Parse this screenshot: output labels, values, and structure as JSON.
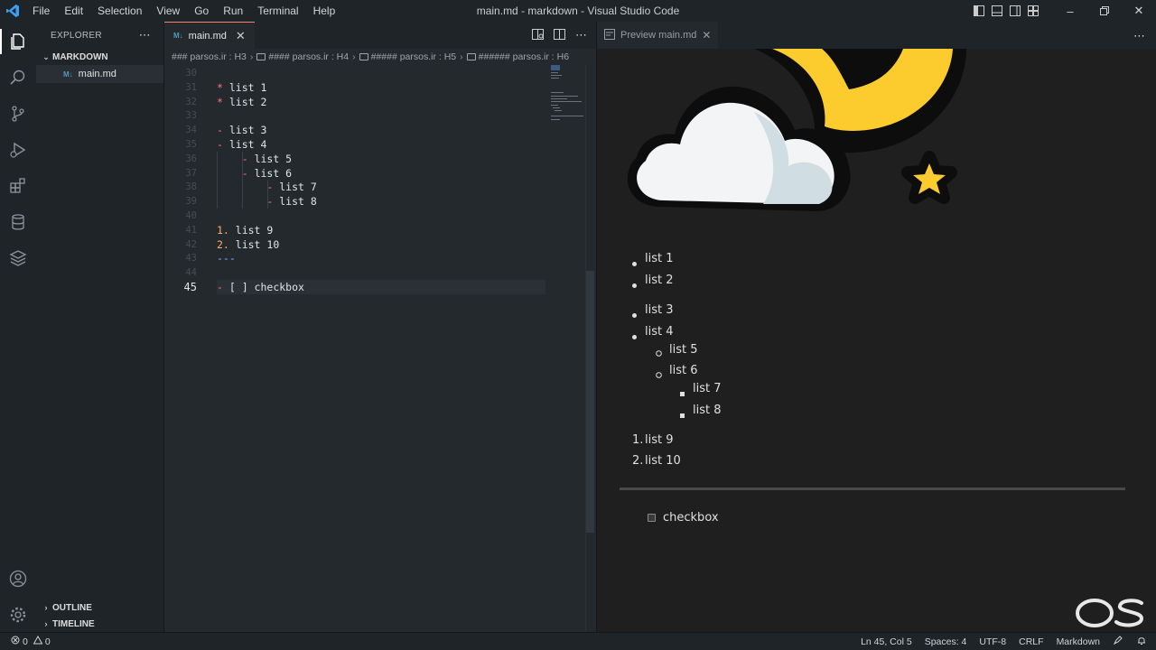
{
  "window": {
    "title": "main.md - markdown - Visual Studio Code",
    "menu": [
      "File",
      "Edit",
      "Selection",
      "View",
      "Go",
      "Run",
      "Terminal",
      "Help"
    ]
  },
  "sidebar": {
    "header": "EXPLORER",
    "folder": "MARKDOWN",
    "file": "main.md",
    "outline": "OUTLINE",
    "timeline": "TIMELINE"
  },
  "editor": {
    "tab_label": "main.md",
    "breadcrumb": [
      "### parsos.ir : H3",
      "#### parsos.ir : H4",
      "##### parsos.ir : H5",
      "###### parsos.ir : H6"
    ],
    "lines": [
      {
        "n": "30",
        "t": ""
      },
      {
        "n": "31",
        "m": "*",
        "t": " list 1"
      },
      {
        "n": "32",
        "m": "*",
        "t": " list 2"
      },
      {
        "n": "33",
        "t": ""
      },
      {
        "n": "34",
        "m": "-",
        "t": " list 3"
      },
      {
        "n": "35",
        "m": "-",
        "t": " list 4"
      },
      {
        "n": "36",
        "indent": "    ",
        "m": "-",
        "t": " list 5"
      },
      {
        "n": "37",
        "indent": "    ",
        "m": "-",
        "t": " list 6"
      },
      {
        "n": "38",
        "indent": "        ",
        "m": "-",
        "t": " list 7"
      },
      {
        "n": "39",
        "indent": "        ",
        "m": "-",
        "t": " list 8"
      },
      {
        "n": "40",
        "t": ""
      },
      {
        "n": "41",
        "num": "1.",
        "t": " list 9"
      },
      {
        "n": "42",
        "num": "2.",
        "t": " list 10"
      },
      {
        "n": "43",
        "hr": "---",
        "t": ""
      },
      {
        "n": "44",
        "t": ""
      },
      {
        "n": "45",
        "m": "-",
        "t": " [ ] checkbox"
      }
    ]
  },
  "preview": {
    "tab_label": "Preview main.md",
    "ul1": [
      "list 1",
      "list 2"
    ],
    "ul2": [
      "list 3",
      "list 4"
    ],
    "ul2_nested": [
      "list 5",
      "list 6"
    ],
    "ul2_nested2": [
      "list 7",
      "list 8"
    ],
    "ol": [
      {
        "marker": "1.",
        "text": "list 9"
      },
      {
        "marker": "2.",
        "text": "list 10"
      }
    ],
    "checkbox_label": "checkbox"
  },
  "status": {
    "errors": "0",
    "warnings": "0",
    "position": "Ln 45, Col 5",
    "spaces": "Spaces: 4",
    "encoding": "UTF-8",
    "eol": "CRLF",
    "language": "Markdown"
  },
  "colors": {
    "accent": "#0078d4",
    "list_marker": "#f97583",
    "number_marker": "#ffab70",
    "hr": "#79b8ff"
  }
}
